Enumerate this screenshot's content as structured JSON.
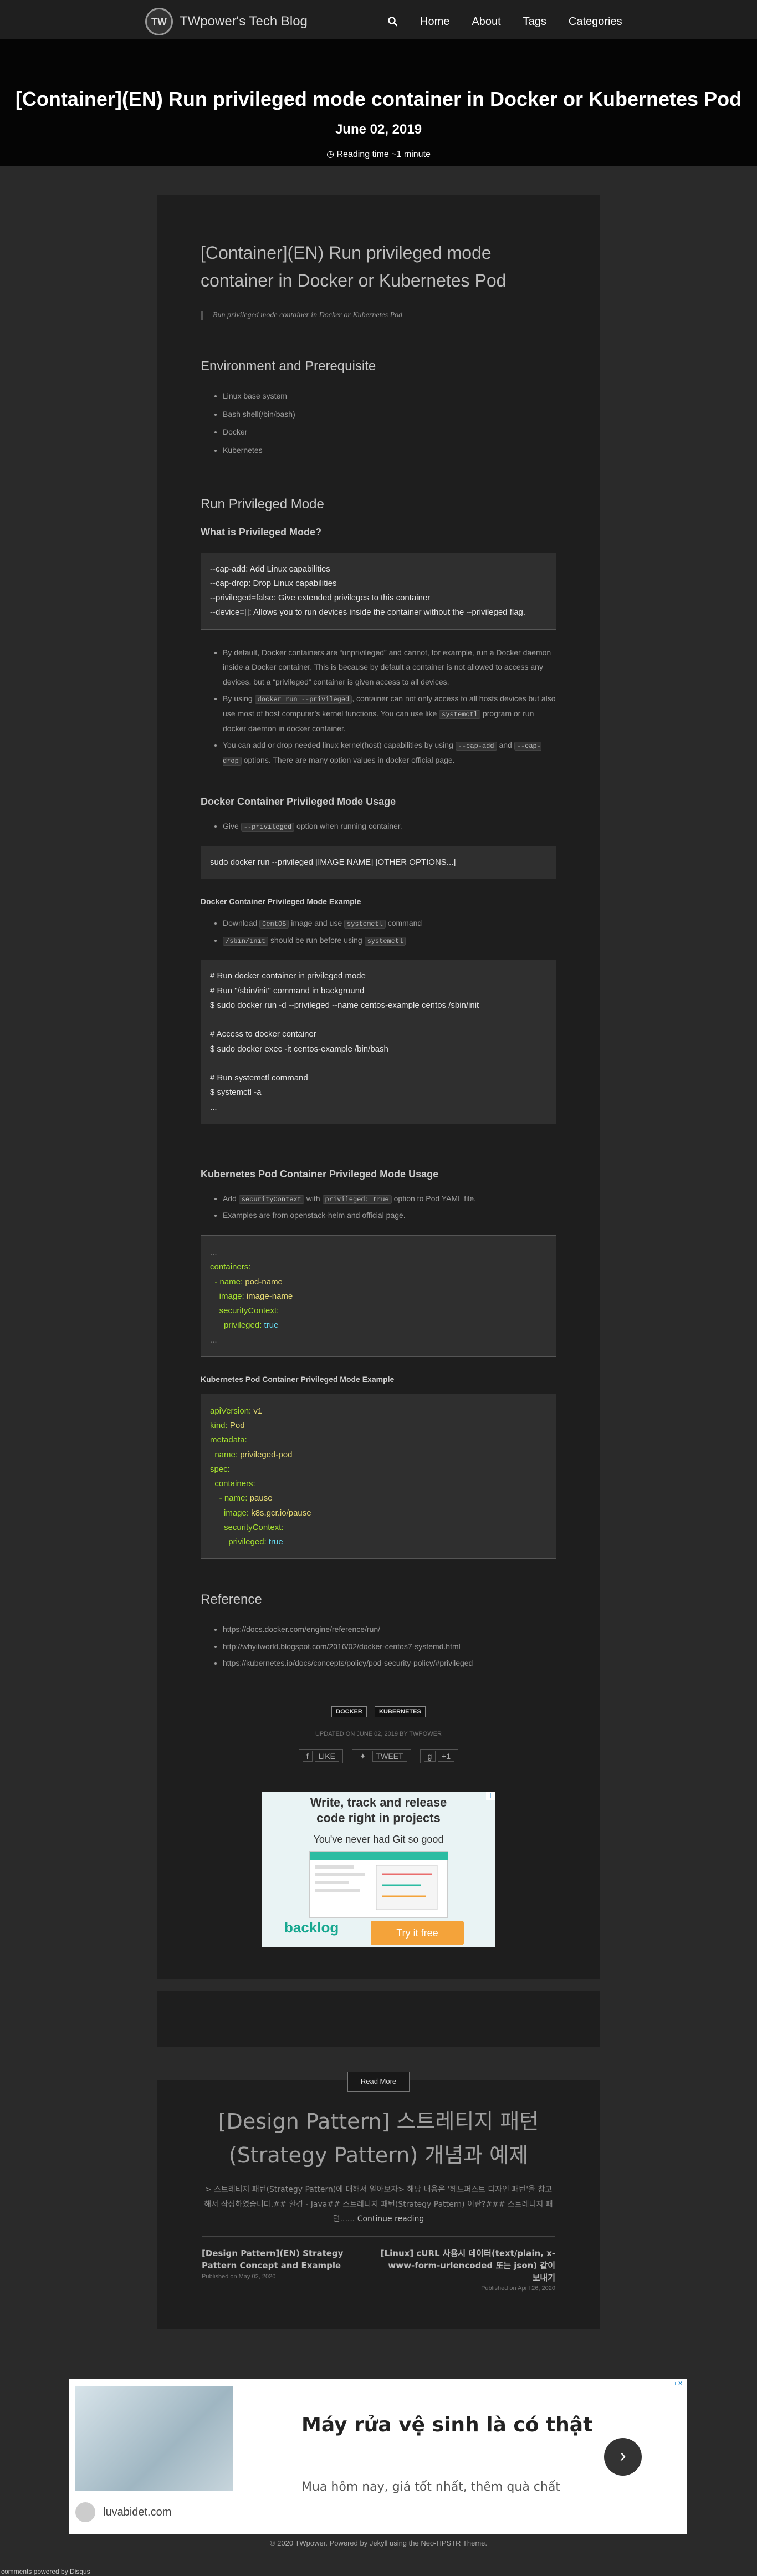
{
  "nav": {
    "logo_text": "TW",
    "brand": "TWpower's Tech Blog",
    "links": [
      "Home",
      "About",
      "Tags",
      "Categories"
    ]
  },
  "hero": {
    "title": "[Container](EN) Run privileged mode container in Docker or Kubernetes Pod",
    "date": "June 02, 2019",
    "reading_time": "Reading time ~1 minute"
  },
  "post": {
    "title": "[Container](EN) Run privileged mode container in Docker or Kubernetes Pod",
    "subtitle": "Run privileged mode container in Docker or Kubernetes Pod",
    "env_heading": "Environment and Prerequisite",
    "env_items": [
      "Linux base system",
      "Bash shell(/bin/bash)",
      "Docker",
      "Kubernetes"
    ],
    "run_heading": "Run Privileged Mode",
    "what_heading": "What is Privileged Mode?",
    "caps_code": "--cap-add: Add Linux capabilities\n--cap-drop: Drop Linux capabilities\n--privileged=false: Give extended privileges to this container\n--device=[]: Allows you to run devices inside the container without the --privileged flag.",
    "bullets": {
      "b1": "By default, Docker containers are “unprivileged” and cannot, for example, run a Docker daemon inside a Docker container. This is because by default a container is not allowed to access any devices, but a “privileged” container is given access to all devices.",
      "b2_a": "By using",
      "b2_code1": "docker run --privileged",
      "b2_b": ", container can not only access to all hosts devices but also use most of host computer’s kernel functions. You can use like",
      "b2_code2": "systemctl",
      "b2_c": "program or run docker daemon in docker container.",
      "b3_a": "You can add or drop needed linux kernel(host) capabilities by using",
      "b3_code1": "--cap-add",
      "b3_b": "and",
      "b3_code2": "--cap-drop",
      "b3_c": "options. There are many option values in docker official page."
    },
    "docker_usage_heading": "Docker Container Privileged Mode Usage",
    "docker_usage_a": "Give",
    "docker_usage_code": "--privileged",
    "docker_usage_b": "option when running container.",
    "docker_usage_cmd": "sudo docker run --privileged [IMAGE NAME] [OTHER OPTIONS...]",
    "docker_example_heading": "Docker Container Privileged Mode Example",
    "docker_ex_1a": "Download",
    "docker_ex_1code1": "CentOS",
    "docker_ex_1b": "image and use",
    "docker_ex_1code2": "systemctl",
    "docker_ex_1c": "command",
    "docker_ex_2code1": "/sbin/init",
    "docker_ex_2a": "should be run before using",
    "docker_ex_2code2": "systemctl",
    "docker_example_code": "# Run docker container in privileged mode\n# Run \"/sbin/init\" command in background\n$ sudo docker run -d --privileged --name centos-example centos /sbin/init\n\n# Access to docker container\n$ sudo docker exec -it centos-example /bin/bash\n\n# Run systemctl command\n$ systemctl -a\n...",
    "k8s_usage_heading": "Kubernetes Pod Container Privileged Mode Usage",
    "k8s_usage_1a": "Add",
    "k8s_usage_1code1": "securityContext",
    "k8s_usage_1b": "with",
    "k8s_usage_1code2": "privileged: true",
    "k8s_usage_1c": "option to Pod YAML file.",
    "k8s_usage_2": "Examples are from openstack-helm and official page.",
    "k8s_snippet": {
      "l1": "...",
      "l2": "containers:",
      "l3a": "  - name: ",
      "l3b": "pod-name",
      "l4a": "    image: ",
      "l4b": "image-name",
      "l5": "    securityContext:",
      "l6a": "      privileged: ",
      "l6b": "true",
      "l7": "..."
    },
    "k8s_example_heading": "Kubernetes Pod Container Privileged Mode Example",
    "k8s_example": {
      "l1a": "apiVersion: ",
      "l1b": "v1",
      "l2a": "kind: ",
      "l2b": "Pod",
      "l3": "metadata:",
      "l4a": "  name: ",
      "l4b": "privileged-pod",
      "l5": "spec:",
      "l6": "  containers:",
      "l7a": "    - name: ",
      "l7b": "pause",
      "l8a": "      image: ",
      "l8b": "k8s.gcr.io/pause",
      "l9": "      securityContext:",
      "l10a": "        privileged: ",
      "l10b": "true"
    },
    "reference_heading": "Reference",
    "references": [
      "https://docs.docker.com/engine/reference/run/",
      "http://whyitworld.blogspot.com/2016/02/docker-centos7-systemd.html",
      "https://kubernetes.io/docs/concepts/policy/pod-security-policy/#privileged"
    ],
    "tags": [
      "DOCKER",
      "KUBERNETES"
    ],
    "updated": "UPDATED ON JUNE 02, 2019 BY TWPOWER",
    "social": [
      "LIKE",
      "TWEET",
      "+1"
    ]
  },
  "ad_top": {
    "title_line1": "Write, track and release",
    "title_line2": "code right in projects",
    "subtitle": "You've never had Git so good",
    "brand": "backlog",
    "button": "Try it free",
    "info": "i"
  },
  "read_more": "Read More",
  "preview": {
    "title": "[Design Pattern] 스트레티지 패턴(Strategy Pattern) 개념과 예제",
    "excerpt": "> 스트레티지 패턴(Strategy Pattern)에 대해서 알아보자> 해당 내용은 '헤드퍼스트 디자인 패턴'을 참고해서 작성하였습니다.## 환경 - Java## 스트레티지 패턴(Strategy Pattern) 이란?### 스트레티지 패턴......",
    "continue": "Continue reading",
    "prev_title": "[Design Pattern](EN) Strategy Pattern Concept and Example",
    "prev_date": "Published on May 02, 2020",
    "next_title": "[Linux] cURL 사용시 데이터(text/plain, x-www-form-urlencoded 또는 json) 같이 보내기",
    "next_date": "Published on April 26, 2020"
  },
  "ad_bottom": {
    "title": "Máy rửa vệ sinh là có thật",
    "subtitle": "Mua hôm nay, giá tốt nhất, thêm quà chất",
    "domain": "luvabidet.com",
    "info": "i ✕"
  },
  "footer": "© 2020 TWpower. Powered by Jekyll using the Neo-HPSTR Theme.",
  "disqus": "comments powered by Disqus"
}
